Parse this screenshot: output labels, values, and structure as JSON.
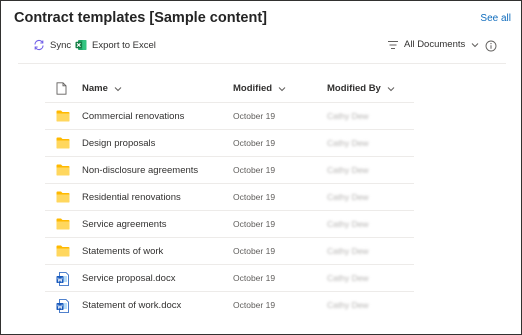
{
  "header": {
    "title": "Contract templates [Sample content]",
    "see_all": "See all"
  },
  "commands": {
    "sync": "Sync",
    "export": "Export to Excel",
    "view": "All Documents"
  },
  "columns": {
    "name": "Name",
    "modified": "Modified",
    "modified_by": "Modified By"
  },
  "rows": [
    {
      "name": "Commercial renovations",
      "modified": "October 19",
      "modified_by": "Cathy Dew",
      "type": "folder-icon"
    },
    {
      "name": "Design proposals",
      "modified": "October 19",
      "modified_by": "Cathy Dew",
      "type": "folder-icon"
    },
    {
      "name": "Non-disclosure agreements",
      "modified": "October 19",
      "modified_by": "Cathy Dew",
      "type": "folder-icon"
    },
    {
      "name": "Residential renovations",
      "modified": "October 19",
      "modified_by": "Cathy Dew",
      "type": "folder-icon"
    },
    {
      "name": "Service agreements",
      "modified": "October 19",
      "modified_by": "Cathy Dew",
      "type": "folder-icon"
    },
    {
      "name": "Statements of work",
      "modified": "October 19",
      "modified_by": "Cathy Dew",
      "type": "folder-icon"
    },
    {
      "name": "Service proposal.docx",
      "modified": "October 19",
      "modified_by": "Cathy Dew",
      "type": "word-doc-icon"
    },
    {
      "name": "Statement of work.docx",
      "modified": "October 19",
      "modified_by": "Cathy Dew",
      "type": "word-doc-icon"
    }
  ],
  "colors": {
    "accent": "#0f6cbd",
    "folder": "#ffb900",
    "word": "#185abd",
    "excel": "#107c41",
    "border": "#323130"
  }
}
